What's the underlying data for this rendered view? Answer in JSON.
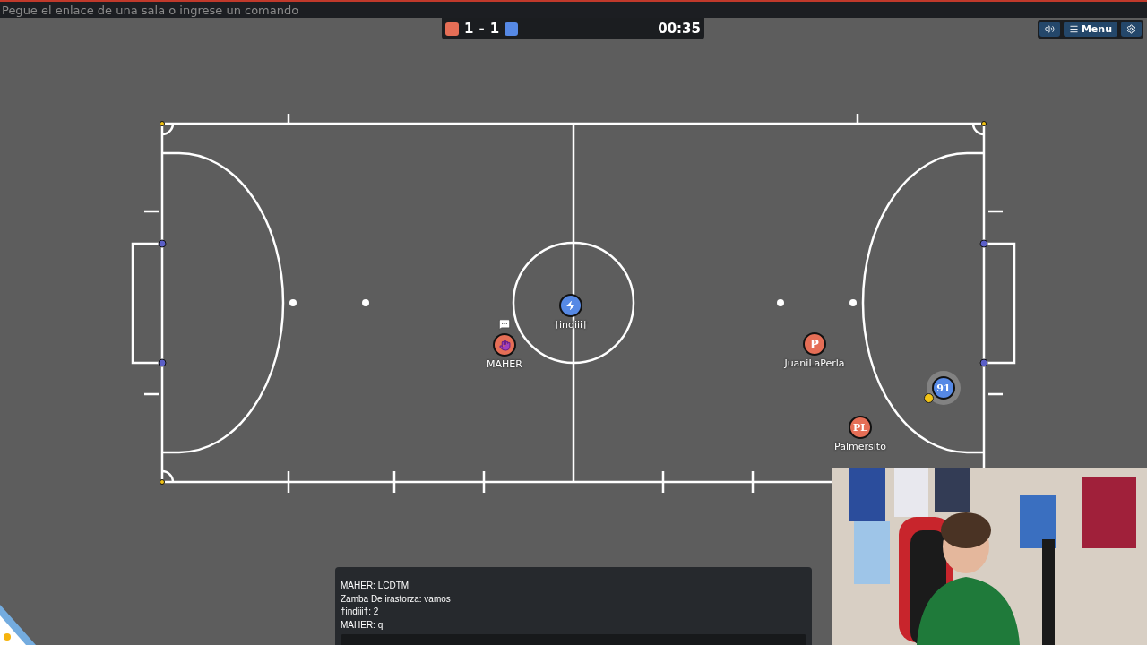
{
  "address_bar": {
    "placeholder": "Pegue el enlace de una sala o ingrese un comando"
  },
  "scoreboard": {
    "red_score": "1",
    "separator": "-",
    "blue_score": "1",
    "time": "00:35"
  },
  "toolbar": {
    "menu_label": "Menu"
  },
  "players": [
    {
      "name": "†indiii†",
      "color": "#5689e5",
      "kind": "icon",
      "chatting": false,
      "kicking": false
    },
    {
      "name": "MAHER",
      "color": "#e56e56",
      "kind": "icon",
      "chatting": true,
      "kicking": false
    },
    {
      "name": "JuaniLaPerla",
      "color": "#e56e56",
      "kind": "text",
      "avatar": "P",
      "chatting": false,
      "kicking": false
    },
    {
      "name": "Palmersito",
      "color": "#e56e56",
      "kind": "text",
      "avatar": "PL",
      "chatting": false,
      "kicking": false
    },
    {
      "color": "#5689e5",
      "kind": "text",
      "avatar": "91",
      "chatting": false,
      "kicking": true
    }
  ],
  "chat": {
    "messages": [
      "MAHER: LCDTM",
      "Zamba De irastorza: vamos",
      "†indiii†: 2",
      "MAHER: q"
    ]
  }
}
